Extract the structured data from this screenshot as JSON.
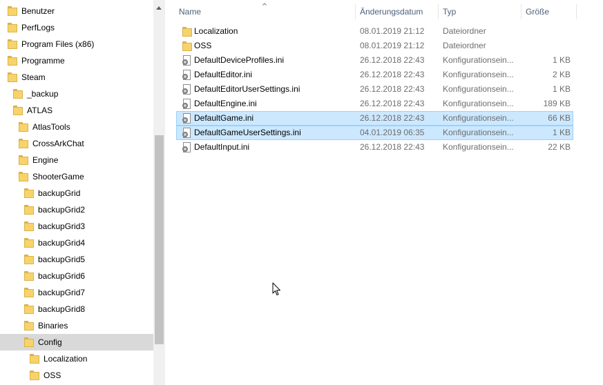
{
  "navigation": {
    "items": [
      {
        "label": "Benutzer"
      },
      {
        "label": "PerfLogs"
      },
      {
        "label": "Program Files (x86)"
      },
      {
        "label": "Programme"
      },
      {
        "label": "Steam"
      },
      {
        "label": "_backup"
      },
      {
        "label": "ATLAS"
      },
      {
        "label": "AtlasTools"
      },
      {
        "label": "CrossArkChat"
      },
      {
        "label": "Engine"
      },
      {
        "label": "ShooterGame"
      },
      {
        "label": "backupGrid"
      },
      {
        "label": "backupGrid2"
      },
      {
        "label": "backupGrid3"
      },
      {
        "label": "backupGrid4"
      },
      {
        "label": "backupGrid5"
      },
      {
        "label": "backupGrid6"
      },
      {
        "label": "backupGrid7"
      },
      {
        "label": "backupGrid8"
      },
      {
        "label": "Binaries"
      },
      {
        "label": "Config"
      },
      {
        "label": "Localization"
      },
      {
        "label": "OSS"
      }
    ],
    "selected": "Config"
  },
  "file_list": {
    "columns": {
      "name": "Name",
      "modified": "Änderungsdatum",
      "type": "Typ",
      "size": "Größe"
    },
    "sort_column": "name",
    "rows": [
      {
        "name": "Localization",
        "modified": "08.01.2019 21:12",
        "type": "Dateiordner",
        "size": "",
        "icon": "folder-icon",
        "selected": false
      },
      {
        "name": "OSS",
        "modified": "08.01.2019 21:12",
        "type": "Dateiordner",
        "size": "",
        "icon": "folder-icon",
        "selected": false
      },
      {
        "name": "DefaultDeviceProfiles.ini",
        "modified": "26.12.2018 22:43",
        "type": "Konfigurationsein...",
        "size": "1 KB",
        "icon": "ini-file-icon",
        "selected": false
      },
      {
        "name": "DefaultEditor.ini",
        "modified": "26.12.2018 22:43",
        "type": "Konfigurationsein...",
        "size": "2 KB",
        "icon": "ini-file-icon",
        "selected": false
      },
      {
        "name": "DefaultEditorUserSettings.ini",
        "modified": "26.12.2018 22:43",
        "type": "Konfigurationsein...",
        "size": "1 KB",
        "icon": "ini-file-icon",
        "selected": false
      },
      {
        "name": "DefaultEngine.ini",
        "modified": "26.12.2018 22:43",
        "type": "Konfigurationsein...",
        "size": "189 KB",
        "icon": "ini-file-icon",
        "selected": false
      },
      {
        "name": "DefaultGame.ini",
        "modified": "26.12.2018 22:43",
        "type": "Konfigurationsein...",
        "size": "66 KB",
        "icon": "ini-file-icon",
        "selected": true
      },
      {
        "name": "DefaultGameUserSettings.ini",
        "modified": "04.01.2019 06:35",
        "type": "Konfigurationsein...",
        "size": "1 KB",
        "icon": "ini-file-icon",
        "selected": true
      },
      {
        "name": "DefaultInput.ini",
        "modified": "26.12.2018 22:43",
        "type": "Konfigurationsein...",
        "size": "22 KB",
        "icon": "ini-file-icon",
        "selected": false
      }
    ]
  },
  "colors": {
    "selection_bg": "#cce8ff",
    "selection_border": "#99d1ff",
    "nav_selected_bg": "#d9d9d9",
    "header_text": "#4c607a",
    "folder_yellow": "#f7d36b"
  }
}
